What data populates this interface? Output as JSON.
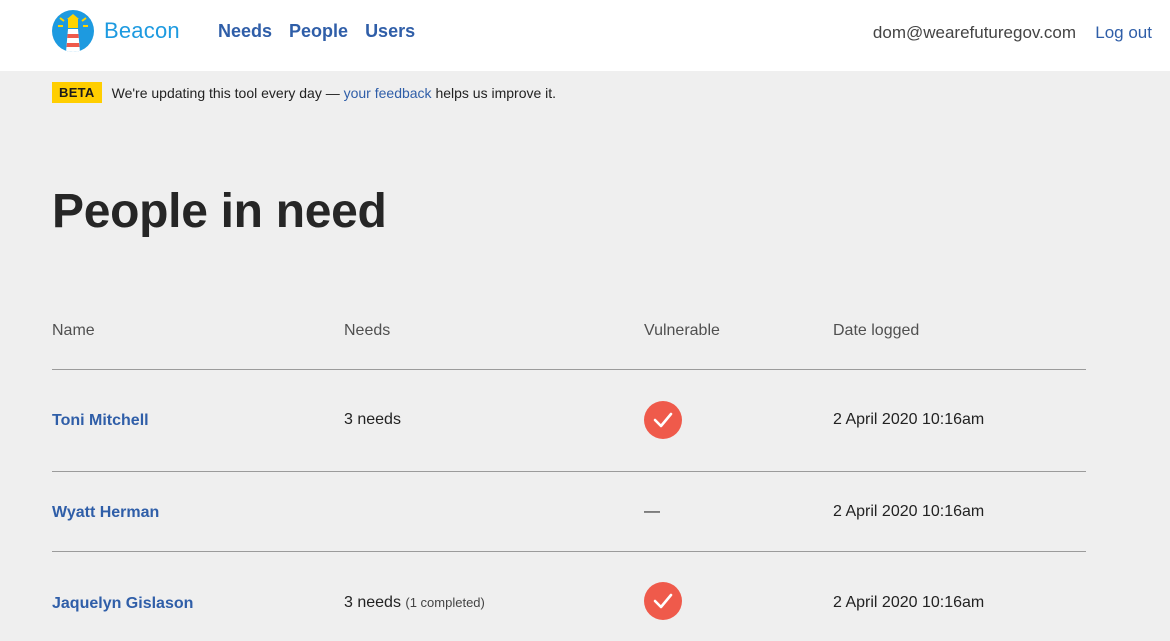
{
  "header": {
    "brand": "Beacon",
    "nav": [
      "Needs",
      "People",
      "Users"
    ],
    "user_email": "dom@wearefuturegov.com",
    "logout_label": "Log out"
  },
  "beta": {
    "tag": "BETA",
    "text_before": "We're updating this tool every day — ",
    "link_text": "your feedback",
    "text_after": " helps us improve it."
  },
  "page": {
    "title": "People in need"
  },
  "table": {
    "headers": {
      "name": "Name",
      "needs": "Needs",
      "vulnerable": "Vulnerable",
      "date": "Date logged"
    },
    "rows": [
      {
        "name": "Toni Mitchell",
        "needs": "3 needs",
        "needs_sub": "",
        "vulnerable": true,
        "vulnerable_text": "",
        "date": "2 April 2020 10:16am"
      },
      {
        "name": "Wyatt Herman",
        "needs": "",
        "needs_sub": "",
        "vulnerable": false,
        "vulnerable_text": "—",
        "date": "2 April 2020 10:16am"
      },
      {
        "name": "Jaquelyn Gislason",
        "needs": "3 needs",
        "needs_sub": "(1 completed)",
        "vulnerable": true,
        "vulnerable_text": "",
        "date": "2 April 2020 10:16am"
      }
    ]
  },
  "colors": {
    "brand": "#1d9ae0",
    "link": "#2f5ea8",
    "beta": "#ffce00",
    "check": "#ef5a4b",
    "background": "#efefef"
  },
  "icons": {
    "logo": "lighthouse-icon",
    "vulnerable": "check-icon"
  }
}
